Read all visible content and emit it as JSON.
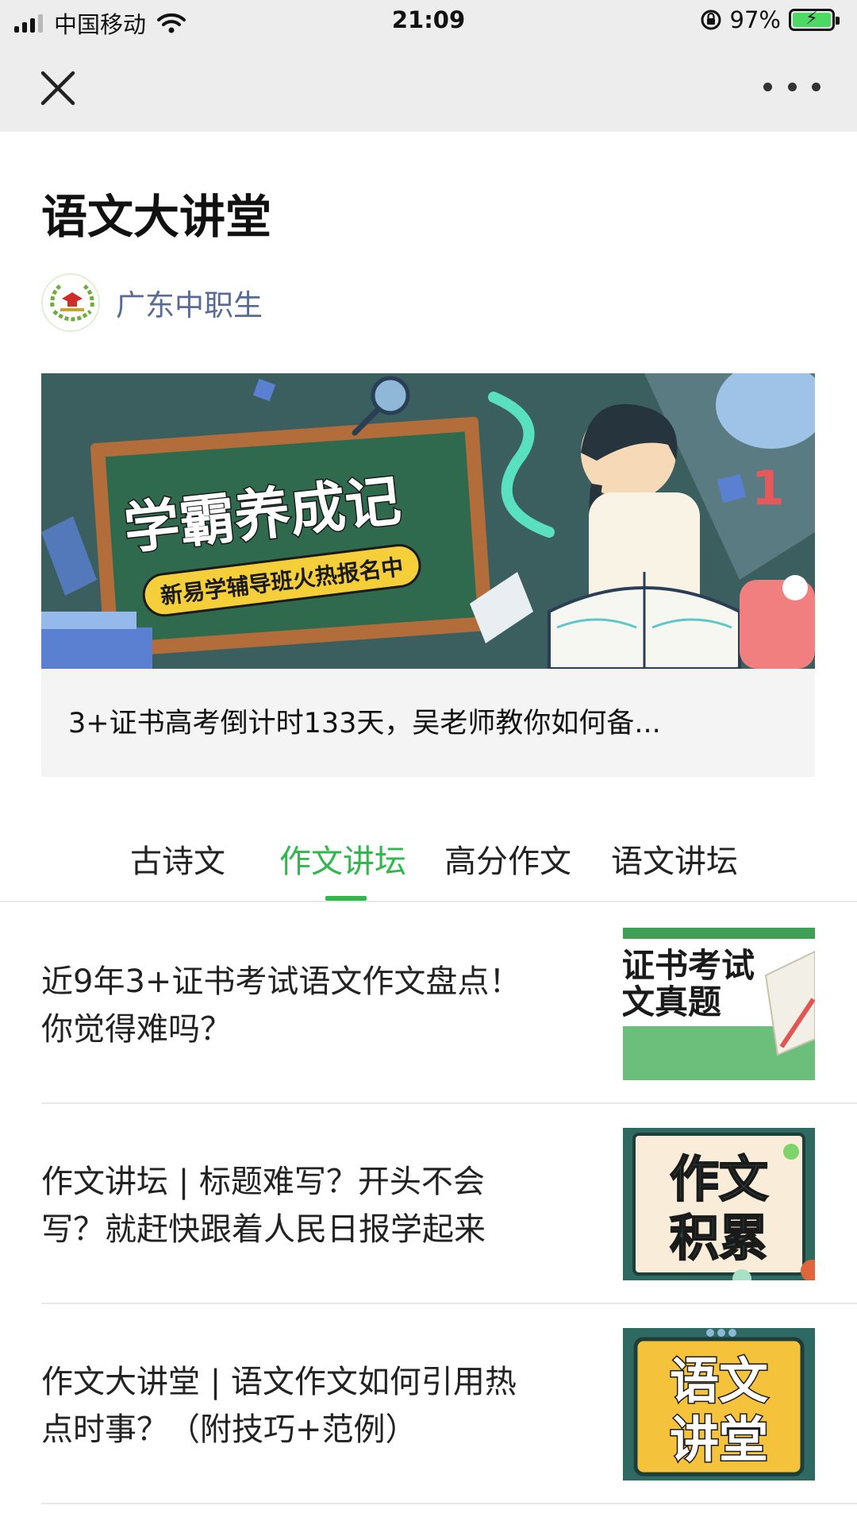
{
  "status_bar": {
    "carrier": "中国移动",
    "time": "21:09",
    "battery": "97%",
    "icons": [
      "signal-icon",
      "wifi-icon",
      "rotation-lock-icon",
      "battery-charging-icon"
    ]
  },
  "nav": {
    "close_icon": "close-icon",
    "more_icon": "more-icon"
  },
  "header": {
    "title": "语文大讲堂",
    "account_name": "广东中职生"
  },
  "banner": {
    "headline": "学霸养成记",
    "tagline": "新易学辅导班火热报名中",
    "caption": "3+证书高考倒计时133天，吴老师教你如何备..."
  },
  "tabs": [
    {
      "label": "古诗文",
      "active": false
    },
    {
      "label": "作文讲坛",
      "active": true
    },
    {
      "label": "高分作文",
      "active": false
    },
    {
      "label": "语文讲坛",
      "active": false
    }
  ],
  "articles": [
    {
      "line1": "近9年3+证书考试语文作文盘点！",
      "line2": "你觉得难吗？",
      "thumb_lines": [
        "证书考试",
        "文真题"
      ]
    },
    {
      "line1": "作文讲坛 | 标题难写？开头不会",
      "line2": "写？就赶快跟着人民日报学起来",
      "thumb_lines": [
        "作文",
        "积累"
      ]
    },
    {
      "line1": "作文大讲堂 | 语文作文如何引用热",
      "line2": "点时事？（附技巧+范例）",
      "thumb_lines": [
        "语文",
        "讲堂"
      ]
    }
  ],
  "colors": {
    "accent": "#2fb84c",
    "link": "#576b95",
    "topbar": "#ededed"
  }
}
